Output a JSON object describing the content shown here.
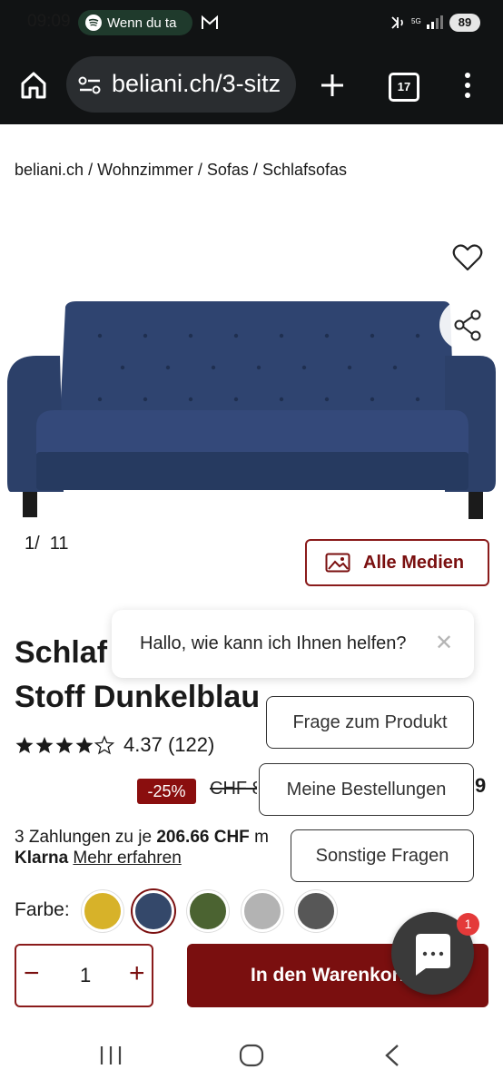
{
  "status_bar": {
    "time": "09:09",
    "media_pill": "Wenn du ta",
    "battery": "89"
  },
  "browser": {
    "url": "beliani.ch/3-sitz",
    "tab_count": "17"
  },
  "breadcrumb": [
    "beliani.ch",
    "Wohnzimmer",
    "Sofas",
    "Schlafsofas"
  ],
  "breadcrumb_separator": "/",
  "gallery": {
    "counter_current": "1",
    "counter_total": "11",
    "all_media_label": "Alle Medien"
  },
  "product": {
    "title_line1": "Schlaf",
    "title_line2": "Stoff Dunkelblau",
    "rating_value": "4.37",
    "rating_count": "(122)",
    "rating_stars": 4.37,
    "discount": "-25%",
    "old_price": "CHF 8",
    "price_fragment": "9",
    "installments_prefix": "3 Zahlungen zu je ",
    "installments_amount": "206.66 CHF",
    "installments_suffix": " m",
    "klarna_brand": "Klarna",
    "klarna_link": "Mehr erfahren",
    "color_label": "Farbe:",
    "colors": [
      "#d7b229",
      "#34486a",
      "#4b6331",
      "#b3b3b3",
      "#575757"
    ],
    "selected_color": 1,
    "quantity": "1",
    "add_to_cart": "In den Warenkorb"
  },
  "chat": {
    "greeting": "Hallo, wie kann ich Ihnen helfen?",
    "options": [
      "Frage zum Produkt",
      "Meine Bestellungen",
      "Sonstige Fragen"
    ],
    "badge": "1"
  },
  "colors": {
    "brand": "#7a0f0f",
    "browser_bar": "#111314",
    "sofa": "#2f4470"
  }
}
